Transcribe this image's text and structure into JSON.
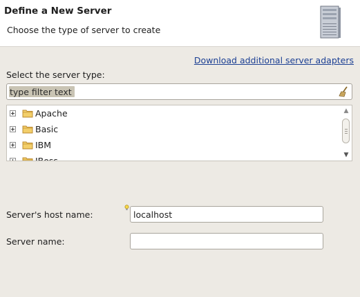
{
  "header": {
    "title": "Define a New Server",
    "description": "Choose the type of server to create",
    "icon": "server-tower-icon"
  },
  "download_link": "Download additional server adapters",
  "server_type": {
    "label": "Select the server type:",
    "filter_placeholder": "type filter text",
    "clear_icon": "broom-icon",
    "tree_items": [
      {
        "label": "Apache",
        "icon": "folder-icon"
      },
      {
        "label": "Basic",
        "icon": "folder-icon"
      },
      {
        "label": "IBM",
        "icon": "folder-icon"
      },
      {
        "label": "JBoss",
        "icon": "folder-icon"
      }
    ]
  },
  "host": {
    "label": "Server's host name:",
    "value": "localhost",
    "hint_icon": "lightbulb-icon"
  },
  "server_name": {
    "label": "Server name:",
    "value": ""
  },
  "colors": {
    "background": "#edeae4",
    "link": "#1b3f93",
    "folder": "#e8b83c"
  }
}
